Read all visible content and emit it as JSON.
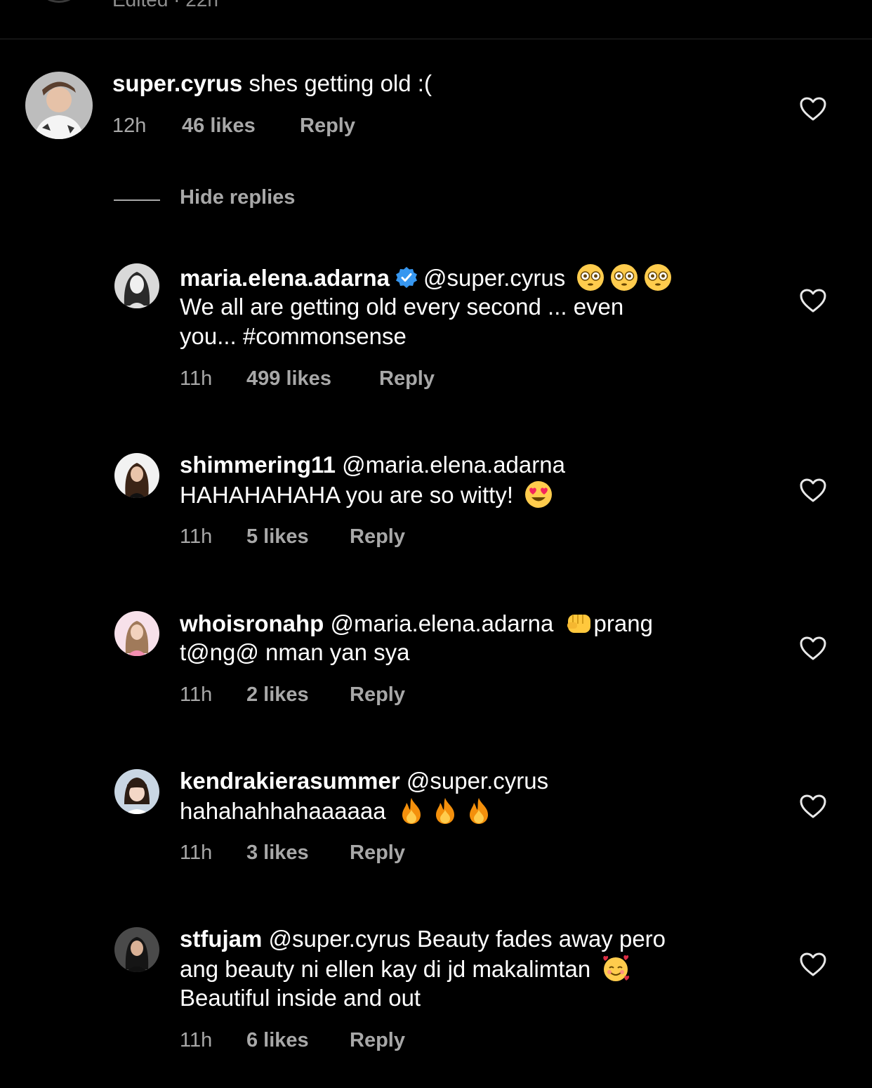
{
  "top_partial": {
    "meta": "Edited · 22h"
  },
  "main_comment": {
    "username": "super.cyrus",
    "text": "shes getting old :(",
    "time": "12h",
    "likes": "46 likes",
    "reply": "Reply"
  },
  "hide_replies_label": "Hide replies",
  "replies": [
    {
      "username": "maria.elena.adarna",
      "verified": true,
      "mention": "@super.cyrus",
      "line1_tail": "",
      "line2": "We all are getting old every second ... even",
      "line3": "you... #commonsense",
      "emoji": [
        "flushed-face",
        "flushed-face",
        "flushed-face"
      ],
      "time": "11h",
      "likes": "499 likes",
      "reply": "Reply"
    },
    {
      "username": "shimmering11",
      "mention": "@maria.elena.adarna",
      "line2": "HAHAHAHAHA you are so witty!",
      "emoji": [
        "heart-eyes-face"
      ],
      "time": "11h",
      "likes": "5 likes",
      "reply": "Reply"
    },
    {
      "username": "whoisronahp",
      "mention": "@maria.elena.adarna",
      "line1_tail": "prang",
      "line2": "t@ng@ nman yan sya",
      "emoji": [
        "oncoming-fist"
      ],
      "time": "11h",
      "likes": "2 likes",
      "reply": "Reply"
    },
    {
      "username": "kendrakierasummer",
      "mention": "@super.cyrus",
      "line2": "hahahahhahaaaaaa",
      "emoji": [
        "fire",
        "fire",
        "fire"
      ],
      "time": "11h",
      "likes": "3 likes",
      "reply": "Reply"
    },
    {
      "username": "stfujam",
      "mention": "@super.cyrus",
      "line1_tail": "Beauty fades away pero",
      "line2": "ang beauty ni ellen kay di jd makalimtan",
      "line3": "Beautiful inside and out",
      "emoji": [
        "smiling-face-with-hearts"
      ],
      "time": "11h",
      "likes": "6 likes",
      "reply": "Reply"
    }
  ],
  "colors": {
    "background": "#000000",
    "text": "#ffffff",
    "meta": "#a8a8a8",
    "verified": "#3797f0"
  }
}
